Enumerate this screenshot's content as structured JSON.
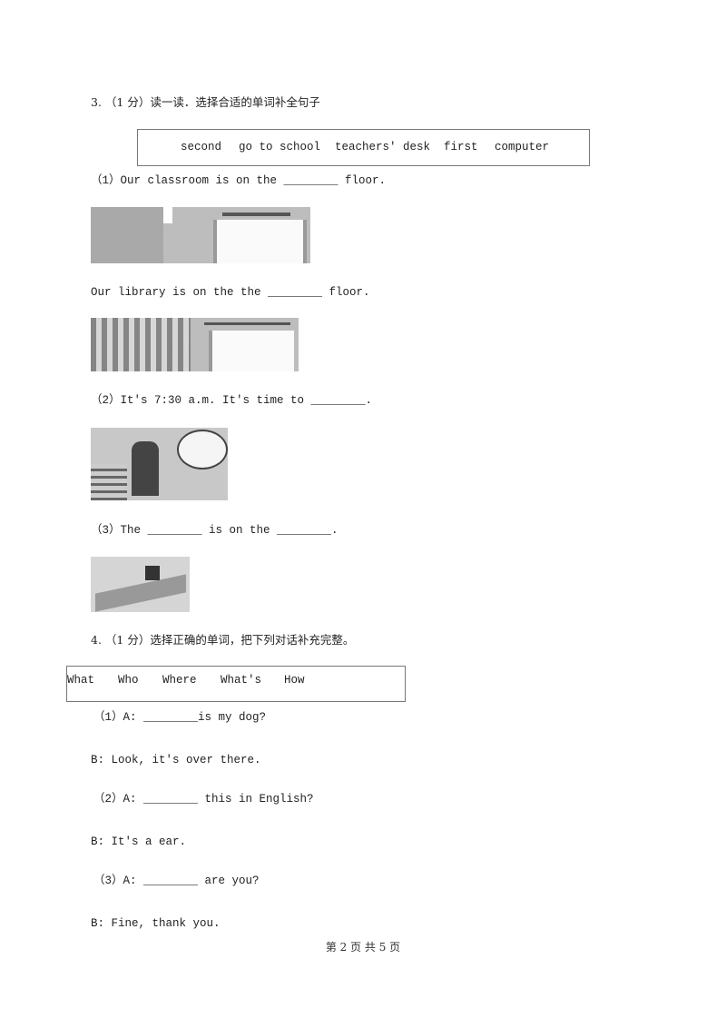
{
  "q3": {
    "title": "3. （1 分）读一读．选择合适的单词补全句子",
    "words": [
      "second",
      "go to school",
      "teachers' desk",
      "first",
      "computer"
    ],
    "s1": "（1）Our classroom is on the ________ floor.",
    "s1b": "Our library is on the the ________ floor.",
    "s2": "（2）It's 7:30 a.m. It's time to ________.",
    "s3": "（3）The ________ is on the ________.",
    "images": [
      "classroom-door-picture",
      "library-stairs-picture",
      "clock-boy-picture",
      "desk-computer-picture"
    ]
  },
  "q4": {
    "title": "4. （1 分）选择正确的单词，把下列对话补充完整。",
    "words": [
      "What",
      "Who",
      "Where",
      "What's",
      "How"
    ],
    "d1a": "（1）A: ________is my dog?",
    "d1b": "B: Look, it's over there.",
    "d2a": "（2）A: ________ this in English?",
    "d2b": "B: It's a ear.",
    "d3a": "（3）A: ________ are you?",
    "d3b": "B: Fine, thank you."
  },
  "footer": "第 2 页 共 5 页"
}
